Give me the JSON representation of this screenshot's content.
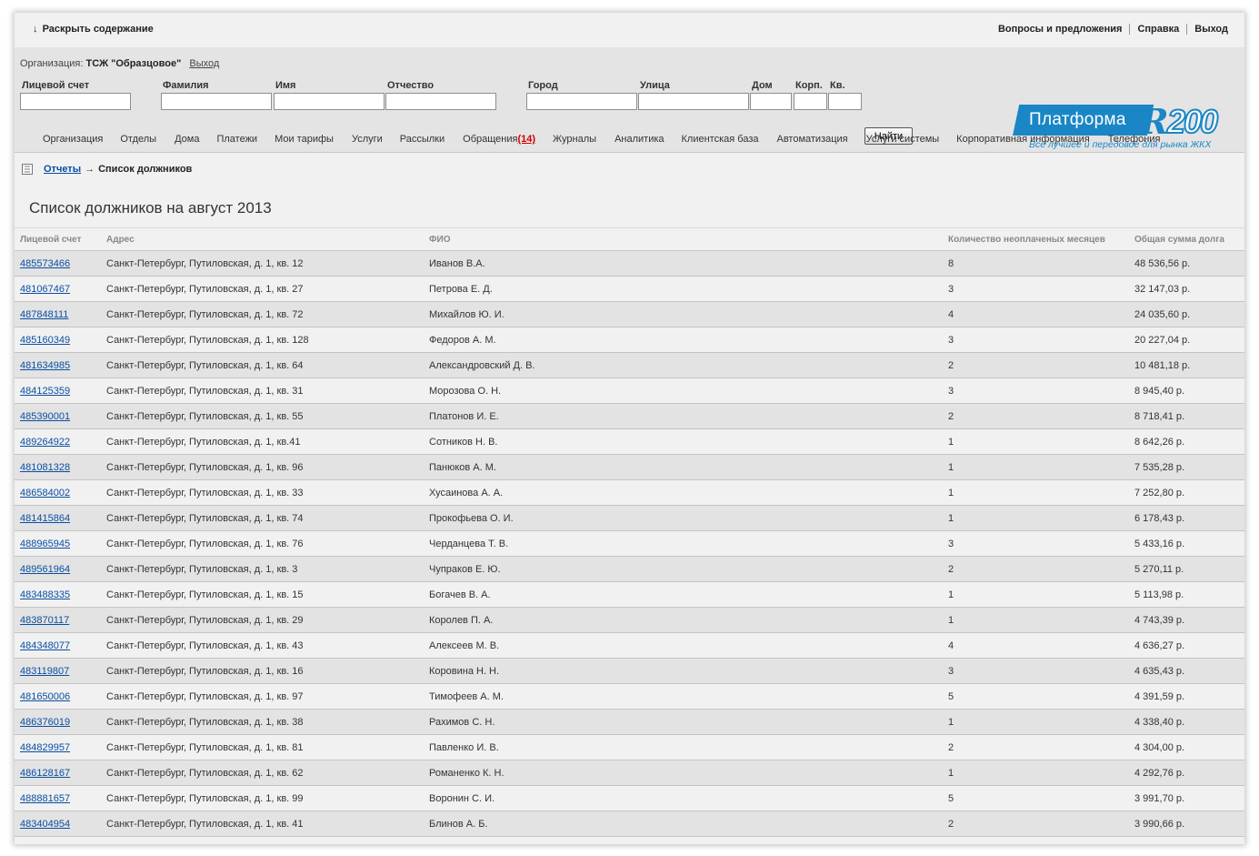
{
  "topbar": {
    "expand_arrow": "↓",
    "expand_label": "Раскрыть содержание",
    "links": [
      "Вопросы и предложения",
      "Справка",
      "Выход"
    ]
  },
  "header": {
    "org_label": "Организация:",
    "org_name": "ТСЖ \"Образцовое\"",
    "org_logout": "Выход",
    "fields": {
      "account": {
        "label": "Лицевой счет",
        "value": ""
      },
      "lastname": {
        "label": "Фамилия",
        "value": ""
      },
      "firstname": {
        "label": "Имя",
        "value": ""
      },
      "patronymic": {
        "label": "Отчество",
        "value": ""
      },
      "city": {
        "label": "Город",
        "value": ""
      },
      "street": {
        "label": "Улица",
        "value": ""
      },
      "house": {
        "label": "Дом",
        "value": ""
      },
      "building": {
        "label": "Корп.",
        "value": ""
      },
      "apartment": {
        "label": "Кв.",
        "value": ""
      }
    },
    "find_button": "Найти",
    "logo": {
      "text": "Платформа",
      "r": "R",
      "num": "200",
      "tagline": "Все лучшее и передовое для рынка ЖКХ",
      "color": "#1a86c6"
    }
  },
  "nav": {
    "items": [
      "Организация",
      "Отделы",
      "Дома",
      "Платежи",
      "Мои тарифы",
      "Услуги",
      "Рассылки",
      "Обращения",
      "Журналы",
      "Аналитика",
      "Клиентская база",
      "Автоматизация",
      "Услуги системы",
      "Корпоративная информация",
      "Телефония"
    ],
    "badge": "(14)"
  },
  "breadcrumb": {
    "icon": "document-icon",
    "link": "Отчеты",
    "sep": "→",
    "current": "Список должников"
  },
  "page_title": "Список должников на август 2013",
  "table": {
    "headers": [
      "Лицевой счет",
      "Адрес",
      "ФИО",
      "Количество неоплаченых месяцев",
      "Общая сумма долга"
    ],
    "rows": [
      [
        "485573466",
        "Санкт-Петербург, Путиловская, д. 1, кв. 12",
        "Иванов В.А.",
        "8",
        "48 536,56 р."
      ],
      [
        "481067467",
        "Санкт-Петербург, Путиловская, д. 1, кв. 27",
        "Петрова Е. Д.",
        "3",
        "32 147,03 р."
      ],
      [
        "487848111",
        "Санкт-Петербург, Путиловская, д. 1, кв. 72",
        "Михайлов Ю. И.",
        "4",
        "24 035,60 р."
      ],
      [
        "485160349",
        "Санкт-Петербург, Путиловская, д. 1, кв. 128",
        "Федоров А. М.",
        "3",
        "20 227,04 р."
      ],
      [
        "481634985",
        "Санкт-Петербург, Путиловская, д. 1, кв. 64",
        "Александровский Д. В.",
        "2",
        "10 481,18 р."
      ],
      [
        "484125359",
        "Санкт-Петербург, Путиловская, д. 1, кв. 31",
        "Морозова О. Н.",
        "3",
        "8 945,40 р."
      ],
      [
        "485390001",
        "Санкт-Петербург, Путиловская, д. 1, кв. 55",
        "Платонов И. Е.",
        "2",
        "8 718,41 р."
      ],
      [
        "489264922",
        "Санкт-Петербург, Путиловская, д. 1, кв.41",
        "Сотников Н. В.",
        "1",
        "8 642,26 р."
      ],
      [
        "481081328",
        "Санкт-Петербург, Путиловская, д. 1, кв. 96",
        "Панюков А. М.",
        "1",
        "7 535,28 р."
      ],
      [
        "486584002",
        "Санкт-Петербург, Путиловская, д. 1, кв. 33",
        "Хусаинова А. А.",
        "1",
        "7 252,80 р."
      ],
      [
        "481415864",
        "Санкт-Петербург, Путиловская, д. 1, кв. 74",
        "Прокофьева О. И.",
        "1",
        "6 178,43 р."
      ],
      [
        "488965945",
        "Санкт-Петербург, Путиловская, д. 1, кв. 76",
        "Черданцева Т. В.",
        "3",
        "5 433,16 р."
      ],
      [
        "489561964",
        "Санкт-Петербург, Путиловская, д. 1, кв. 3",
        "Чупраков Е. Ю.",
        "2",
        "5 270,11 р."
      ],
      [
        "483488335",
        "Санкт-Петербург, Путиловская, д. 1, кв. 15",
        "Богачев В. А.",
        "1",
        "5 113,98 р."
      ],
      [
        "483870117",
        "Санкт-Петербург, Путиловская, д. 1, кв. 29",
        "Королев П. А.",
        "1",
        "4 743,39 р."
      ],
      [
        "484348077",
        "Санкт-Петербург, Путиловская, д. 1, кв. 43",
        "Алексеев М. В.",
        "4",
        "4 636,27 р."
      ],
      [
        "483119807",
        "Санкт-Петербург, Путиловская, д. 1, кв. 16",
        "Коровина Н. Н.",
        "3",
        "4 635,43 р."
      ],
      [
        "481650006",
        "Санкт-Петербург, Путиловская, д. 1, кв. 97",
        "Тимофеев А. М.",
        "5",
        "4 391,59 р."
      ],
      [
        "486376019",
        "Санкт-Петербург, Путиловская, д. 1, кв. 38",
        "Рахимов С. Н.",
        "1",
        "4 338,40 р."
      ],
      [
        "484829957",
        "Санкт-Петербург, Путиловская, д. 1, кв. 81",
        "Павленко И. В.",
        "2",
        "4 304,00 р."
      ],
      [
        "486128167",
        "Санкт-Петербург, Путиловская, д. 1, кв. 62",
        "Романенко К. Н.",
        "1",
        "4 292,76 р."
      ],
      [
        "488881657",
        "Санкт-Петербург, Путиловская, д. 1, кв. 99",
        "Воронин С. И.",
        "5",
        "3 991,70 р."
      ],
      [
        "483404954",
        "Санкт-Петербург, Путиловская, д. 1, кв. 41",
        "Блинов А. Б.",
        "2",
        "3 990,66 р."
      ]
    ]
  }
}
